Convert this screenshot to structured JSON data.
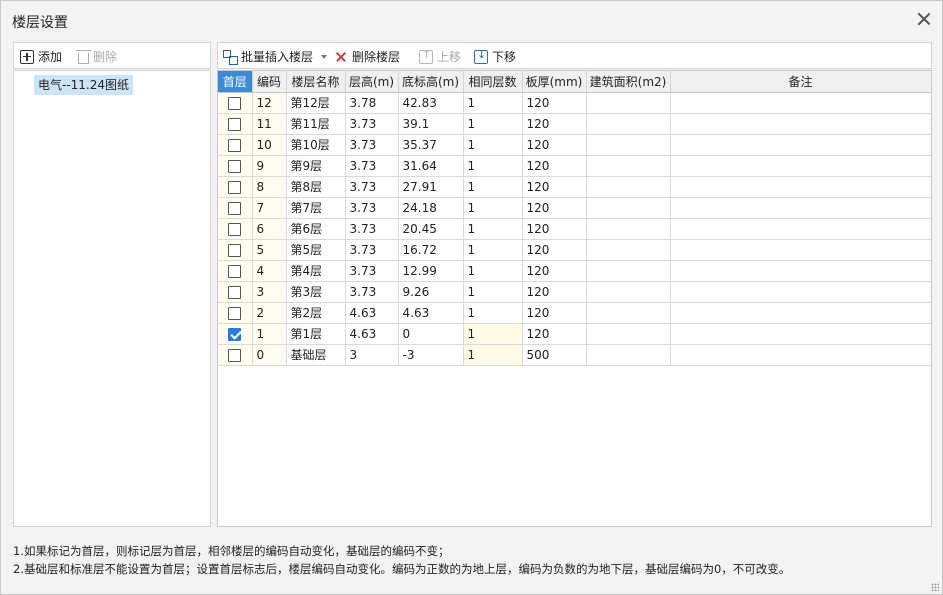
{
  "window": {
    "title": "楼层设置"
  },
  "left_toolbar": {
    "add_label": "添加",
    "delete_label": "删除"
  },
  "projects": [
    {
      "label": "电气--11.24图纸",
      "selected": true
    }
  ],
  "toolbar": {
    "batch_insert_label": "批量插入楼层",
    "delete_floor_label": "删除楼层",
    "move_up_label": "上移",
    "move_down_label": "下移"
  },
  "table": {
    "columns": [
      "首层",
      "编码",
      "楼层名称",
      "层高(m)",
      "底标高(m)",
      "相同层数",
      "板厚(mm)",
      "建筑面积(m2)",
      "备注"
    ],
    "rows": [
      {
        "first": false,
        "code": "12",
        "name": "第12层",
        "height": "3.78",
        "base": "42.83",
        "same": "1",
        "slab": "120",
        "area": "",
        "note": ""
      },
      {
        "first": false,
        "code": "11",
        "name": "第11层",
        "height": "3.73",
        "base": "39.1",
        "same": "1",
        "slab": "120",
        "area": "",
        "note": ""
      },
      {
        "first": false,
        "code": "10",
        "name": "第10层",
        "height": "3.73",
        "base": "35.37",
        "same": "1",
        "slab": "120",
        "area": "",
        "note": ""
      },
      {
        "first": false,
        "code": "9",
        "name": "第9层",
        "height": "3.73",
        "base": "31.64",
        "same": "1",
        "slab": "120",
        "area": "",
        "note": ""
      },
      {
        "first": false,
        "code": "8",
        "name": "第8层",
        "height": "3.73",
        "base": "27.91",
        "same": "1",
        "slab": "120",
        "area": "",
        "note": ""
      },
      {
        "first": false,
        "code": "7",
        "name": "第7层",
        "height": "3.73",
        "base": "24.18",
        "same": "1",
        "slab": "120",
        "area": "",
        "note": ""
      },
      {
        "first": false,
        "code": "6",
        "name": "第6层",
        "height": "3.73",
        "base": "20.45",
        "same": "1",
        "slab": "120",
        "area": "",
        "note": ""
      },
      {
        "first": false,
        "code": "5",
        "name": "第5层",
        "height": "3.73",
        "base": "16.72",
        "same": "1",
        "slab": "120",
        "area": "",
        "note": ""
      },
      {
        "first": false,
        "code": "4",
        "name": "第4层",
        "height": "3.73",
        "base": "12.99",
        "same": "1",
        "slab": "120",
        "area": "",
        "note": ""
      },
      {
        "first": false,
        "code": "3",
        "name": "第3层",
        "height": "3.73",
        "base": "9.26",
        "same": "1",
        "slab": "120",
        "area": "",
        "note": ""
      },
      {
        "first": false,
        "code": "2",
        "name": "第2层",
        "height": "4.63",
        "base": "4.63",
        "same": "1",
        "slab": "120",
        "area": "",
        "note": ""
      },
      {
        "first": true,
        "code": "1",
        "name": "第1层",
        "height": "4.63",
        "base": "0",
        "same": "1",
        "slab": "120",
        "area": "",
        "note": ""
      },
      {
        "first": false,
        "code": "0",
        "name": "基础层",
        "height": "3",
        "base": "-3",
        "same": "1",
        "slab": "500",
        "area": "",
        "note": ""
      }
    ]
  },
  "notes": {
    "line1": "1.如果标记为首层，则标记层为首层，相邻楼层的编码自动变化，基础层的编码不变；",
    "line2": "2.基础层和标准层不能设置为首层；设置首层标志后，楼层编码自动变化。编码为正数的为地上层，编码为负数的为地下层，基础层编码为0，不可改变。"
  }
}
